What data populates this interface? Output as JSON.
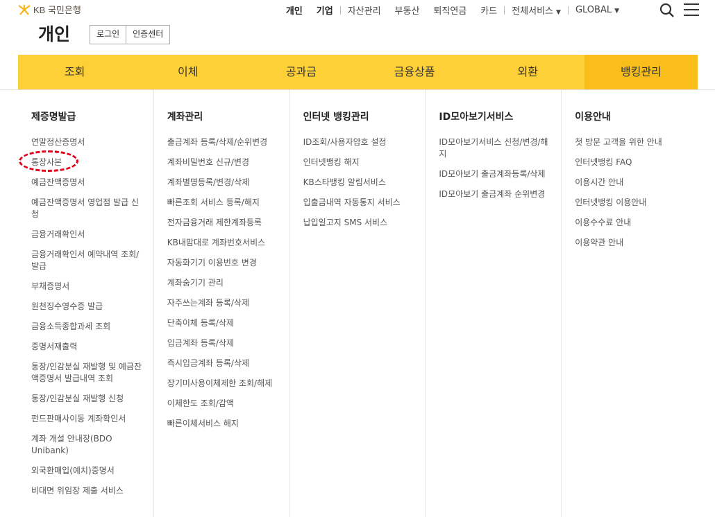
{
  "header": {
    "logo_text": "KB 국민은행",
    "nav": [
      {
        "label": "개인",
        "strong": true
      },
      {
        "label": "기업",
        "strong": true
      },
      {
        "label": "자산관리"
      },
      {
        "label": "부동산"
      },
      {
        "label": "퇴직연금"
      },
      {
        "label": "카드"
      },
      {
        "label": "전체서비스"
      },
      {
        "label": "GLOBAL"
      }
    ],
    "page_title": "개인",
    "login_label": "로그인",
    "cert_label": "인증센터"
  },
  "gnb": {
    "tabs": [
      "조회",
      "이체",
      "공과금",
      "금융상품",
      "외환",
      "뱅킹관리"
    ],
    "active_index": 5,
    "color": "#fdd037",
    "active_color": "#f9be1a"
  },
  "menu": {
    "columns": [
      {
        "title": "제증명발급",
        "items": [
          "연말정산증명서",
          "통장사본",
          "예금잔액증명서",
          "예금잔액증명서 영업점 발급 신청",
          "금융거래확인서",
          "금융거래확인서 예약내역 조회/발급",
          "부채증명서",
          "원천징수영수증 발급",
          "금융소득종합과세 조회",
          "증명서재출력",
          "통장/인감분실 재발행 및 예금잔액증명서 발급내역 조회",
          "통장/인감분실 재발행 신청",
          "펀드판매사이동 계좌확인서",
          "계좌 개설 안내장(BDO Unibank)",
          "외국환매입(예치)증명서",
          "비대면 위임장 제출 서비스"
        ]
      },
      {
        "title": "계좌관리",
        "items": [
          "출금계좌 등록/삭제/순위변경",
          "계좌비밀번호 신규/변경",
          "계좌별명등록/변경/삭제",
          "빠른조회 서비스 등록/해지",
          "전자금융거래 제한계좌등록",
          "KB내맘대로 계좌번호서비스",
          "자동화기기 이용번호 변경",
          "계좌숨기기 관리",
          "자주쓰는계좌 등록/삭제",
          "단축이체 등록/삭제",
          "입금계좌 등록/삭제",
          "즉시입금계좌 등록/삭제",
          "장기미사용이체제한 조회/해제",
          "이체한도 조회/감액",
          "빠른이체서비스 해지"
        ]
      },
      {
        "title": "인터넷 뱅킹관리",
        "items": [
          "ID조회/사용자암호 설정",
          "인터넷뱅킹 해지",
          "KB스타뱅킹 알림서비스",
          "입출금내역 자동통지 서비스",
          "납입일고지 SMS 서비스"
        ]
      },
      {
        "title": "ID모아보기서비스",
        "items": [
          "ID모아보기서비스 신청/변경/해지",
          "ID모아보기 출금계좌등록/삭제",
          "ID모아보기 출금계좌 순위변경"
        ]
      },
      {
        "title": "이용안내",
        "items": [
          "첫 방문 고객을 위한 안내",
          "인터넷뱅킹 FAQ",
          "이용시간 안내",
          "인터넷뱅킹 이용안내",
          "이용수수료 안내",
          "이용약관 안내"
        ]
      }
    ]
  },
  "annotation": {
    "highlighted_item": "통장사본",
    "color": "#e3001b"
  }
}
